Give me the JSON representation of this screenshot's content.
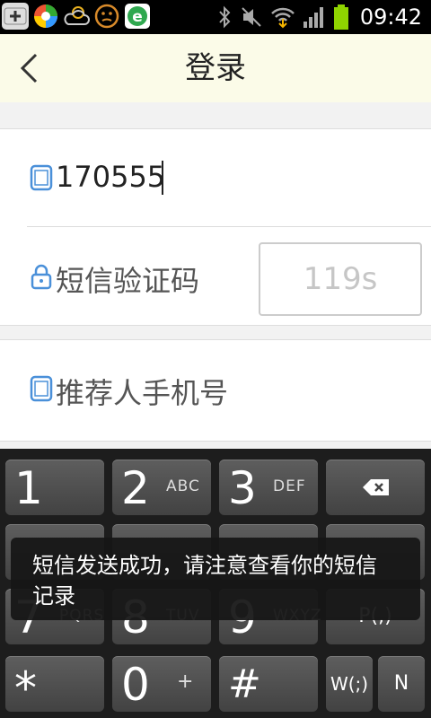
{
  "status_bar": {
    "time": "09:42"
  },
  "header": {
    "title": "登录"
  },
  "form": {
    "phone_value": "170555",
    "sms_code_placeholder": "短信验证码",
    "countdown": "119s",
    "referrer_placeholder": "推荐人手机号"
  },
  "keyboard": {
    "keys": [
      {
        "main": "1",
        "sub": ""
      },
      {
        "main": "2",
        "sub": "ABC"
      },
      {
        "main": "3",
        "sub": "DEF"
      },
      {
        "main": "7",
        "sub": "PQRS"
      },
      {
        "main": "8",
        "sub": "TUV"
      },
      {
        "main": "9",
        "sub": "WXYZ"
      },
      {
        "main": "*",
        "sub": ""
      },
      {
        "main": "0",
        "sub": "+"
      },
      {
        "main": "#",
        "sub": ""
      },
      {
        "main": "W(;)",
        "sub": ""
      },
      {
        "main": "N",
        "sub": ""
      },
      {
        "main": "P(,)",
        "sub": ""
      }
    ]
  },
  "toast": {
    "message": "短信发送成功，请注意查看你的短信记录"
  }
}
